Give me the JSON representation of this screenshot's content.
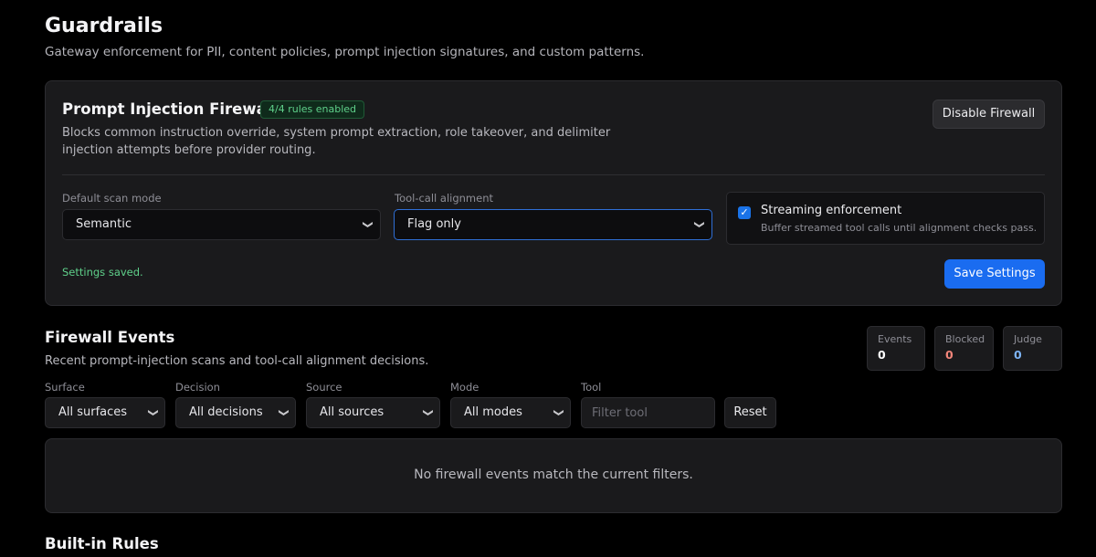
{
  "page": {
    "title": "Guardrails",
    "subtitle": "Gateway enforcement for PII, content policies, prompt injection signatures, and custom patterns."
  },
  "firewall": {
    "title": "Prompt Injection Firewall",
    "badge": "4/4 rules enabled",
    "description": "Blocks common instruction override, system prompt extraction, role takeover, and delimiter injection attempts before provider routing.",
    "disable_label": "Disable Firewall",
    "scan_mode": {
      "label": "Default scan mode",
      "value": "Semantic"
    },
    "alignment": {
      "label": "Tool-call alignment",
      "value": "Flag only"
    },
    "streaming": {
      "checked": true,
      "title": "Streaming enforcement",
      "description": "Buffer streamed tool calls until alignment checks pass."
    },
    "saved_message": "Settings saved.",
    "save_label": "Save Settings"
  },
  "events": {
    "title": "Firewall Events",
    "subtitle": "Recent prompt-injection scans and tool-call alignment decisions.",
    "stats": [
      {
        "label": "Events",
        "value": "0",
        "color": "#ffffff"
      },
      {
        "label": "Blocked",
        "value": "0",
        "color": "#f2857a"
      },
      {
        "label": "Judge",
        "value": "0",
        "color": "#7db4f5"
      }
    ],
    "filters": {
      "surface": {
        "label": "Surface",
        "value": "All surfaces"
      },
      "decision": {
        "label": "Decision",
        "value": "All decisions"
      },
      "source": {
        "label": "Source",
        "value": "All sources"
      },
      "mode": {
        "label": "Mode",
        "value": "All modes"
      },
      "tool": {
        "label": "Tool",
        "placeholder": "Filter tool"
      },
      "reset_label": "Reset"
    },
    "empty_message": "No firewall events match the current filters."
  },
  "builtin": {
    "title": "Built-in Rules"
  },
  "icons": {
    "select": "chevron-down-icon",
    "checkbox": "check-icon"
  },
  "colors": {
    "accent": "#1a6cf0",
    "success": "#5fd08a",
    "danger": "#f2857a",
    "info": "#7db4f5"
  }
}
